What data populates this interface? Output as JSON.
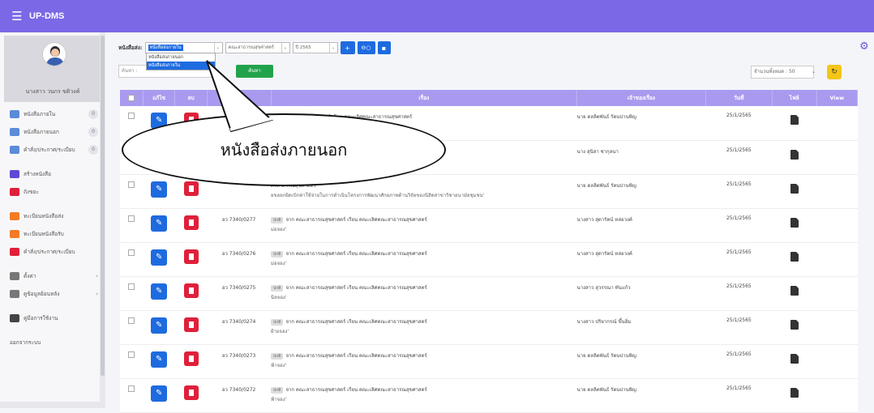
{
  "app": {
    "title": "UP-DMS",
    "menu_icon": "☰"
  },
  "user": {
    "name": "นางสาว วนกร ขติวงค์"
  },
  "sidebar": {
    "items": [
      {
        "label": "หนังสือภายใน",
        "badge": "0",
        "icon": "folder-icon",
        "color": "#5b8bd8"
      },
      {
        "label": "หนังสือภายนอก",
        "badge": "0",
        "icon": "folder-icon",
        "color": "#5b8bd8"
      },
      {
        "label": "คำสั่ง/ประกาศ/ระเบียบ",
        "badge": "0",
        "icon": "folder-icon",
        "color": "#5b8bd8"
      },
      {
        "label": "สร้างหนังสือ",
        "badge": "",
        "icon": "create-icon",
        "color": "#5d4ad3"
      },
      {
        "label": "ถังขยะ",
        "badge": "",
        "icon": "trash-icon",
        "color": "#e0203a"
      },
      {
        "label": "ทะเบียนหนังสือส่ง",
        "badge": "",
        "icon": "send-icon",
        "color": "#f47a28"
      },
      {
        "label": "ทะเบียนหนังสือรับ",
        "badge": "",
        "icon": "receive-icon",
        "color": "#f47a28"
      },
      {
        "label": "คำสั่ง/ประกาศ/ระเบียบ",
        "badge": "",
        "icon": "doc-icon",
        "color": "#e0203a"
      },
      {
        "label": "ตั้งค่า",
        "badge": "",
        "icon": "gear-icon",
        "color": "#777"
      },
      {
        "label": "ดูข้อมูลย้อนหลัง",
        "badge": "",
        "icon": "archive-icon",
        "color": "#777"
      },
      {
        "label": "คู่มือการใช้งาน",
        "badge": "",
        "icon": "book-icon",
        "color": "#444"
      },
      {
        "label": "ออกจากระบบ",
        "badge": "",
        "icon": "",
        "color": "#777"
      }
    ]
  },
  "toolbar": {
    "type_label": "หนังสือส่ง:",
    "type_value": "หนังสือส่งภายใน",
    "type_options": [
      "หนังสือส่งภายนอก",
      "หนังสือส่งภายใน"
    ],
    "dept_value": "คณะสาธารณสุขศาสตร์",
    "year_value": "ปี 2565"
  },
  "search": {
    "placeholder": "ค้นหา :",
    "button": "ค้นหา",
    "count": "จำนวนทั้งหมด : 50"
  },
  "table": {
    "headers": [
      "แก้ไข",
      "ลบ",
      "",
      "เรื่อง",
      "เจ้าของเรื่อง",
      "วันที่",
      "ไฟล์",
      "View"
    ],
    "rows": [
      {
        "no": "",
        "tag": "",
        "subject": "จาก คณะสาธารณสุขศาสตร์ เรียน คณะเลิศคณะสาธารณสุขศาสตร์",
        "line2": "ใน ค่าใช้จ่ายในการจัดสอบ หลักสูตรสาธารณสุขศาสตรบัณฑิต",
        "owner": "นาย ดลลิตพันธ์ รัตนปานพิญ",
        "date": "25/1/2565"
      },
      {
        "no": "",
        "tag": "",
        "subject": "",
        "line2": "การสอน หลักสูตรสาธารณสุขศาสตรมหาบัณ แผน ข",
        "owner": "นาง สุนิสา ชากุลนา",
        "date": "25/1/2565"
      },
      {
        "no": "",
        "tag": "",
        "subject": "ดรสาสารณสุขศาสตร์",
        "line2": "ยขอยกผิดเบิกค่าใช้จ่ายในการดำเนินโครงการพัฒนาศักยภาพด้านวิจัยของนิสิตสาขาวิชาอนามัยชุมชน'",
        "owner": "นาย ดลลิตพันธ์ รัตนปานพิญ",
        "date": "25/1/2565"
      },
      {
        "no": "อว 7340/0277",
        "tag": "ปกติ",
        "subject": "จาก คณะสาธารณสุขศาสตร์ เรียน คณะเลิศคณะสาธารณสุขศาสตร์",
        "line2": "ม่อจอง'",
        "owner": "นางสาว สุดารัตน์ หล่อวงค์",
        "date": "25/1/2565"
      },
      {
        "no": "อว 7340/0276",
        "tag": "ปกติ",
        "subject": "จาก คณะสาธารณสุขศาสตร์ เรียน คณะเลิศคณะสาธารณสุขศาสตร์",
        "line2": "ม่อจอง'",
        "owner": "นางสาว สุดารัตน์ หล่อวงค์",
        "date": "25/1/2565"
      },
      {
        "no": "อว 7340/0275",
        "tag": "ปกติ",
        "subject": "จาก คณะสาธารณสุขศาสตร์ เรียน คณะเลิศคณะสาธารณสุขศาสตร์",
        "line2": "นิลจอง'",
        "owner": "นางสาว สุวรรณา ทันแก้ว",
        "date": "25/1/2565"
      },
      {
        "no": "อว 7340/0274",
        "tag": "ปกติ",
        "subject": "จาก คณะสาธารณสุขศาสตร์ เรียน คณะเลิศคณะสาธารณสุขศาสตร์",
        "line2": "ฝ้ายจอง'",
        "owner": "นางสาว ปริยากรณ์ ขึ้นอิ่ม",
        "date": "25/1/2565"
      },
      {
        "no": "อว 7340/0273",
        "tag": "ปกติ",
        "subject": "จาก คณะสาธารณสุขศาสตร์ เรียน คณะเลิศคณะสาธารณสุขศาสตร์",
        "line2": "ฟ้าจอง'",
        "owner": "นาย ดลลิตพันธ์ รัตนปานพิญ",
        "date": "25/1/2565"
      },
      {
        "no": "อว 7340/0272",
        "tag": "ปกติ",
        "subject": "จาก คณะสาธารณสุขศาสตร์ เรียน คณะเลิศคณะสาธารณสุขศาสตร์",
        "line2": "ฟ้าจอง'",
        "owner": "นาย ดลลิตพันธ์ รัตนปานพิญ",
        "date": "25/1/2565"
      }
    ]
  },
  "callout": {
    "text": "หนังสือส่งภายนอก"
  }
}
